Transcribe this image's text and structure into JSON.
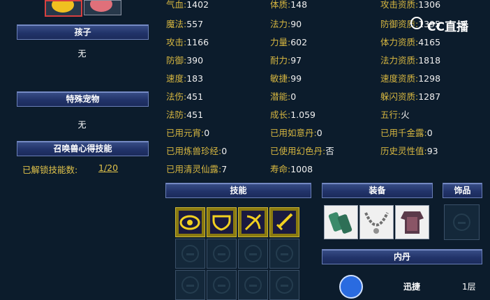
{
  "left_panel": {
    "child_header": "孩子",
    "child_value": "无",
    "special_pet_header": "特殊宠物",
    "special_pet_value": "无",
    "insight_header": "召唤兽心得技能",
    "unlocked_label": "已解锁技能数:",
    "unlocked_value": "1/20"
  },
  "stats": [
    {
      "label": "气血:",
      "value": "1402"
    },
    {
      "label": "体质:",
      "value": "148"
    },
    {
      "label": "攻击资质:",
      "value": "1306"
    },
    {
      "label": "魔法:",
      "value": "557"
    },
    {
      "label": "法力:",
      "value": "90"
    },
    {
      "label": "防御资质:",
      "value": "1395"
    },
    {
      "label": "攻击:",
      "value": "1166"
    },
    {
      "label": "力量:",
      "value": "602"
    },
    {
      "label": "体力资质:",
      "value": "4165"
    },
    {
      "label": "防御:",
      "value": "390"
    },
    {
      "label": "耐力:",
      "value": "97"
    },
    {
      "label": "法力资质:",
      "value": "1818"
    },
    {
      "label": "速度:",
      "value": "183"
    },
    {
      "label": "敏捷:",
      "value": "99"
    },
    {
      "label": "速度资质:",
      "value": "1298"
    },
    {
      "label": "法伤:",
      "value": "451"
    },
    {
      "label": "潜能:",
      "value": "0"
    },
    {
      "label": "躲闪资质:",
      "value": "1287"
    },
    {
      "label": "法防:",
      "value": "451"
    },
    {
      "label": "成长:",
      "value": "1.059"
    },
    {
      "label": "五行:",
      "value": "火"
    },
    {
      "label": "已用元宵:",
      "value": "0"
    },
    {
      "label": "已用如意丹:",
      "value": "0"
    },
    {
      "label": "已用千金露:",
      "value": "0"
    },
    {
      "label": "已用炼兽珍经:",
      "value": "0"
    },
    {
      "label": "已使用幻色丹:",
      "value": "否"
    },
    {
      "label": "历史灵性值:",
      "value": "93"
    },
    {
      "label": "已用清灵仙露:",
      "value": "7"
    },
    {
      "label": "寿命:",
      "value": "1008"
    }
  ],
  "sections": {
    "skills": "技能",
    "equipment": "装备",
    "accessory": "饰品",
    "inner_pill": "内丹"
  },
  "inner_pill_partial": {
    "text1": "迅捷",
    "text2": "1层"
  },
  "watermark": "CC直播",
  "colors": {
    "background": "#0c1c2c",
    "label_yellow": "#d6b640",
    "header_blue": "#22346a"
  }
}
